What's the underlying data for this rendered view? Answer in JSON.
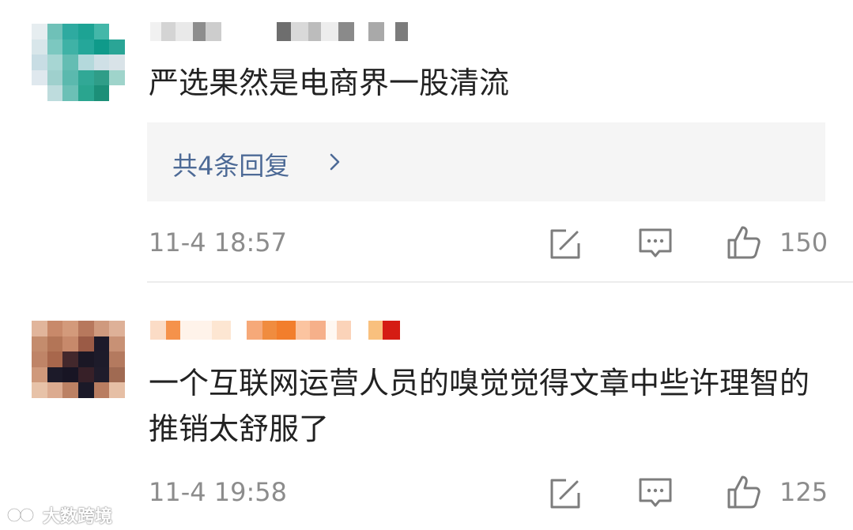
{
  "comments": [
    {
      "text": "严选果然是电商界一股清流",
      "replies_label": "共4条回复",
      "time": "11-4 18:57",
      "likes": "150"
    },
    {
      "text": "一个互联网运营人员的嗅觉觉得文章中些许理智的推销太舒服了",
      "time": "11-4 19:58",
      "likes": "125"
    }
  ],
  "icons": [
    "edit-icon",
    "comment-icon",
    "thumbs-up-icon",
    "chevron-right-icon"
  ],
  "colors": {
    "text": "#222222",
    "meta": "#8c8c8c",
    "reply_link": "#4d6a96",
    "reply_bg": "#f5f5f5"
  },
  "watermark": "大数跨境"
}
